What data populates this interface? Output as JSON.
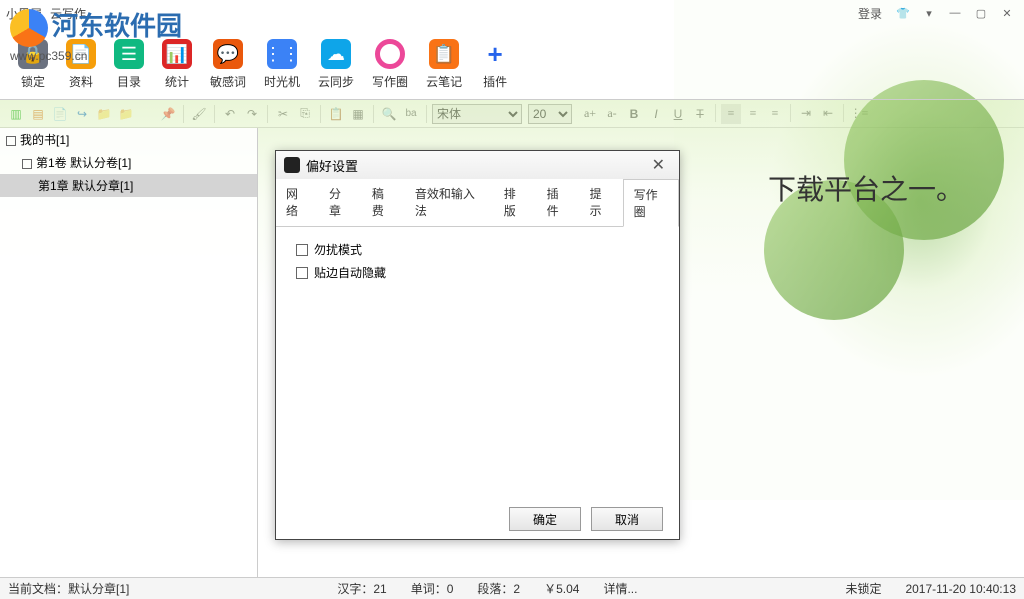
{
  "titlebar": {
    "app_name": "小黑屋",
    "sub_title": "云写作",
    "login": "登录"
  },
  "watermark": {
    "name": "河东软件园",
    "url": "www.pc359.cn"
  },
  "main_tools": [
    {
      "id": "lock",
      "label": "锁定"
    },
    {
      "id": "data",
      "label": "资料"
    },
    {
      "id": "toc",
      "label": "目录"
    },
    {
      "id": "stat",
      "label": "统计"
    },
    {
      "id": "sens",
      "label": "敏感词"
    },
    {
      "id": "time",
      "label": "时光机"
    },
    {
      "id": "cloud",
      "label": "云同步"
    },
    {
      "id": "circle",
      "label": "写作圈"
    },
    {
      "id": "note",
      "label": "云笔记"
    },
    {
      "id": "plugin",
      "label": "插件"
    }
  ],
  "font": {
    "name": "宋体",
    "size": "20"
  },
  "tree": {
    "root": "我的书[1]",
    "vol": "第1卷 默认分卷[1]",
    "chap": "第1章 默认分章[1]"
  },
  "editor_text": "下载平台之一。",
  "dialog": {
    "title": "偏好设置",
    "tabs": [
      "网络",
      "分章",
      "稿费",
      "音效和输入法",
      "排版",
      "插件",
      "提示",
      "写作圈"
    ],
    "active_tab": 7,
    "checks": [
      "勿扰模式",
      "贴边自动隐藏"
    ],
    "ok": "确定",
    "cancel": "取消"
  },
  "status": {
    "doc_label": "当前文档：",
    "doc_name": "默认分章[1]",
    "hanzi": "汉字：21",
    "words": "单词：0",
    "paras": "段落：2",
    "fee": "￥5.04",
    "detail": "详情...",
    "lock": "未锁定",
    "time": "2017-11-20 10:40:13"
  }
}
